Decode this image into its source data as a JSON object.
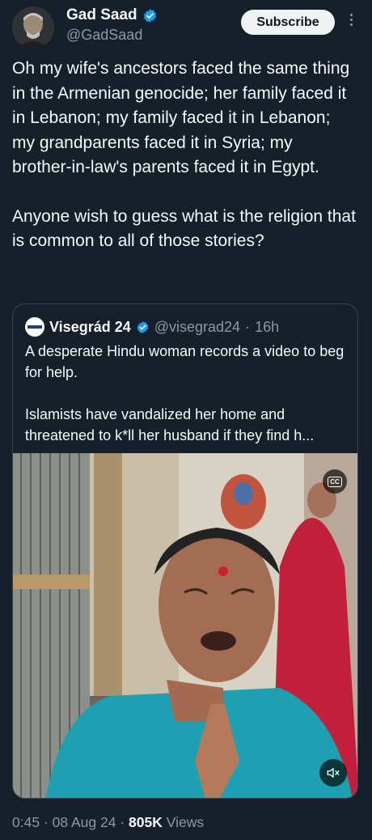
{
  "author": {
    "name": "Gad Saad",
    "handle": "@GadSaad",
    "subscribe_label": "Subscribe"
  },
  "tweet": {
    "paragraphs": [
      "Oh my wife's ancestors faced the same thing in the Armenian genocide; her family faced it in Lebanon; my family faced it in Lebanon; my grandparents faced it in Syria; my brother-in-law's parents faced it in Egypt.",
      "Anyone wish to guess what is the religion that is common to all of those stories?"
    ]
  },
  "quote": {
    "name": "Visegrád 24",
    "handle": "@visegrad24",
    "separator": "·",
    "age": "16h",
    "paragraphs": [
      "A desperate Hindu woman records a video to beg for help.",
      "Islamists have vandalized her home and threatened to k*ll her husband if they find h..."
    ],
    "media": {
      "cc_label": "CC",
      "mute_icon": "volume-muted-icon"
    }
  },
  "footer": {
    "time": "0:45",
    "date": "08 Aug 24",
    "views_count": "805K",
    "views_label": "Views",
    "separator": "·"
  },
  "colors": {
    "background": "#15202b",
    "verified_blue": "#1d9bf0",
    "secondary_text": "#8b98a5",
    "border": "#38444d"
  }
}
